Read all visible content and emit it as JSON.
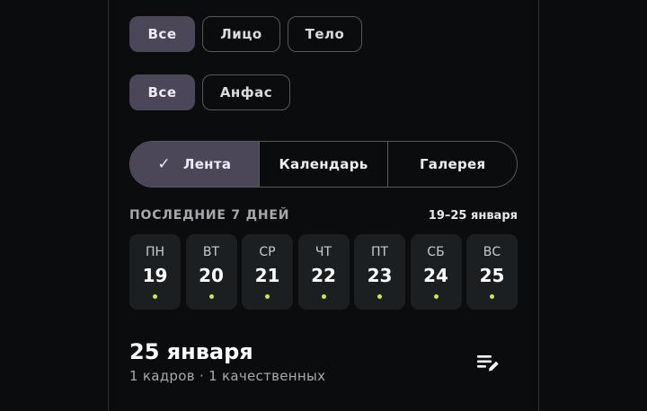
{
  "filters": {
    "group1": [
      {
        "label": "Все",
        "active": true
      },
      {
        "label": "Лицо",
        "active": false
      },
      {
        "label": "Тело",
        "active": false
      }
    ],
    "group2": [
      {
        "label": "Все",
        "active": true
      },
      {
        "label": "Анфас",
        "active": false
      }
    ]
  },
  "view_tabs": {
    "check_glyph": "✓",
    "tabs": [
      {
        "label": "Лента",
        "active": true
      },
      {
        "label": "Календарь",
        "active": false
      },
      {
        "label": "Галерея",
        "active": false
      }
    ]
  },
  "week": {
    "title": "ПОСЛЕДНИЕ 7 ДНЕЙ",
    "range": "19–25 января",
    "days": [
      {
        "dow": "ПН",
        "num": "19"
      },
      {
        "dow": "ВТ",
        "num": "20"
      },
      {
        "dow": "СР",
        "num": "21"
      },
      {
        "dow": "ЧТ",
        "num": "22"
      },
      {
        "dow": "ПТ",
        "num": "23"
      },
      {
        "dow": "СБ",
        "num": "24"
      },
      {
        "dow": "ВС",
        "num": "25"
      }
    ],
    "dot_color": "#c8ef3a"
  },
  "selected_date": {
    "title": "25 января",
    "subtitle": "1 кадров · 1 качественных",
    "edit_icon": "edit-list-icon"
  },
  "colors": {
    "background": "#0b0c0e",
    "active_chip": "#4b4658",
    "day_card": "#1c1f22",
    "accent_dot": "#c8ef3a"
  }
}
